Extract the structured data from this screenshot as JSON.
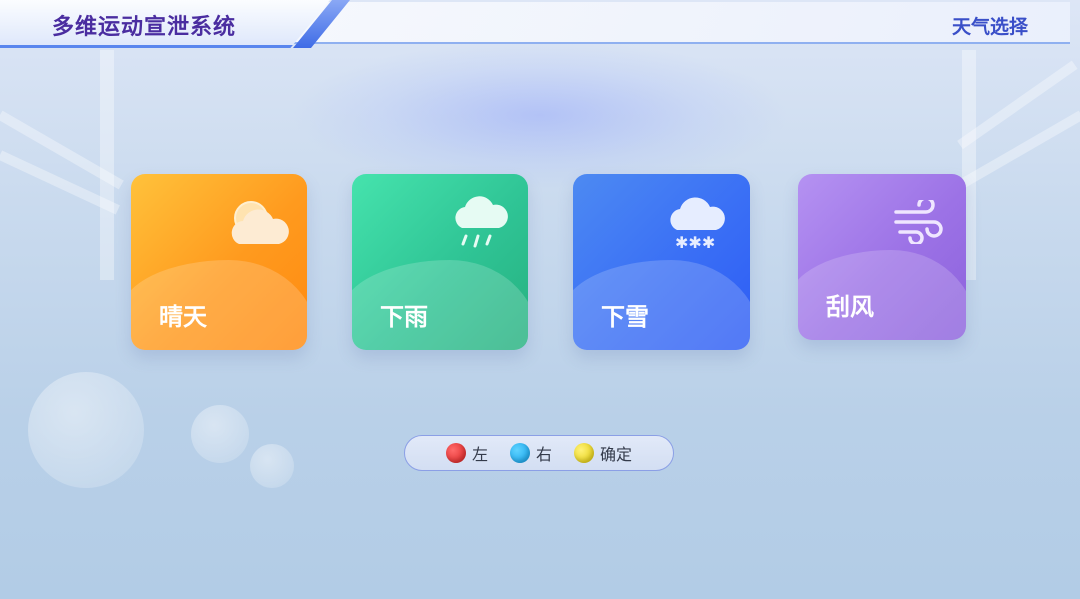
{
  "header": {
    "app_title": "多维运动宣泄系统",
    "page_title": "天气选择"
  },
  "weather_options": [
    {
      "id": "sunny",
      "label": "晴天",
      "icon": "partly-sunny-icon"
    },
    {
      "id": "rain",
      "label": "下雨",
      "icon": "rain-cloud-icon"
    },
    {
      "id": "snow",
      "label": "下雪",
      "icon": "snow-cloud-icon"
    },
    {
      "id": "wind",
      "label": "刮风",
      "icon": "wind-icon"
    }
  ],
  "hints": [
    {
      "color": "red",
      "label": "左"
    },
    {
      "color": "blue",
      "label": "右"
    },
    {
      "color": "yellow",
      "label": "确定"
    }
  ],
  "colors": {
    "title": "#4a2da0",
    "page_title": "#3a4fc8",
    "sunny": "#ff9a1e",
    "rain": "#2fc495",
    "snow": "#3a6ff5",
    "wind": "#9c72e6"
  }
}
